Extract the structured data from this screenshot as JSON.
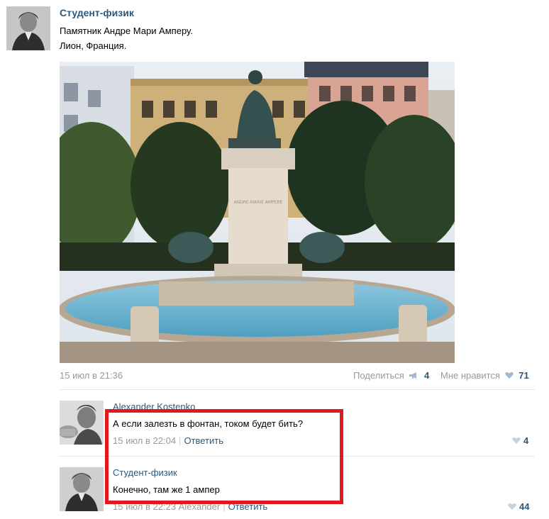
{
  "post": {
    "author": "Студент-физик",
    "text_line1": "Памятник Андре Мари Амперу.",
    "text_line2": "Лион, Франция.",
    "date": "15 июл в 21:36",
    "share_label": "Поделиться",
    "share_count": "4",
    "like_label": "Мне нравится",
    "like_count": "71",
    "photo_plaque": "ANDRE-MARIE AMPERE"
  },
  "comments": [
    {
      "author": "Alexander Kostenko",
      "text": "А если залезть в фонтан, током будет бить?",
      "date": "15 июл в 22:04",
      "reply_label": "Ответить",
      "likes": "4"
    },
    {
      "author": "Студент-физик",
      "text": "Конечно, там же 1 ампер",
      "date": "15 июл в 22:23",
      "reply_to": "Alexander",
      "reply_label": "Ответить",
      "likes": "44"
    }
  ],
  "icons": {
    "share": "megaphone-icon",
    "like": "heart-icon"
  },
  "colors": {
    "link": "#2b587a",
    "muted": "#999999",
    "highlight": "#e0191f"
  }
}
